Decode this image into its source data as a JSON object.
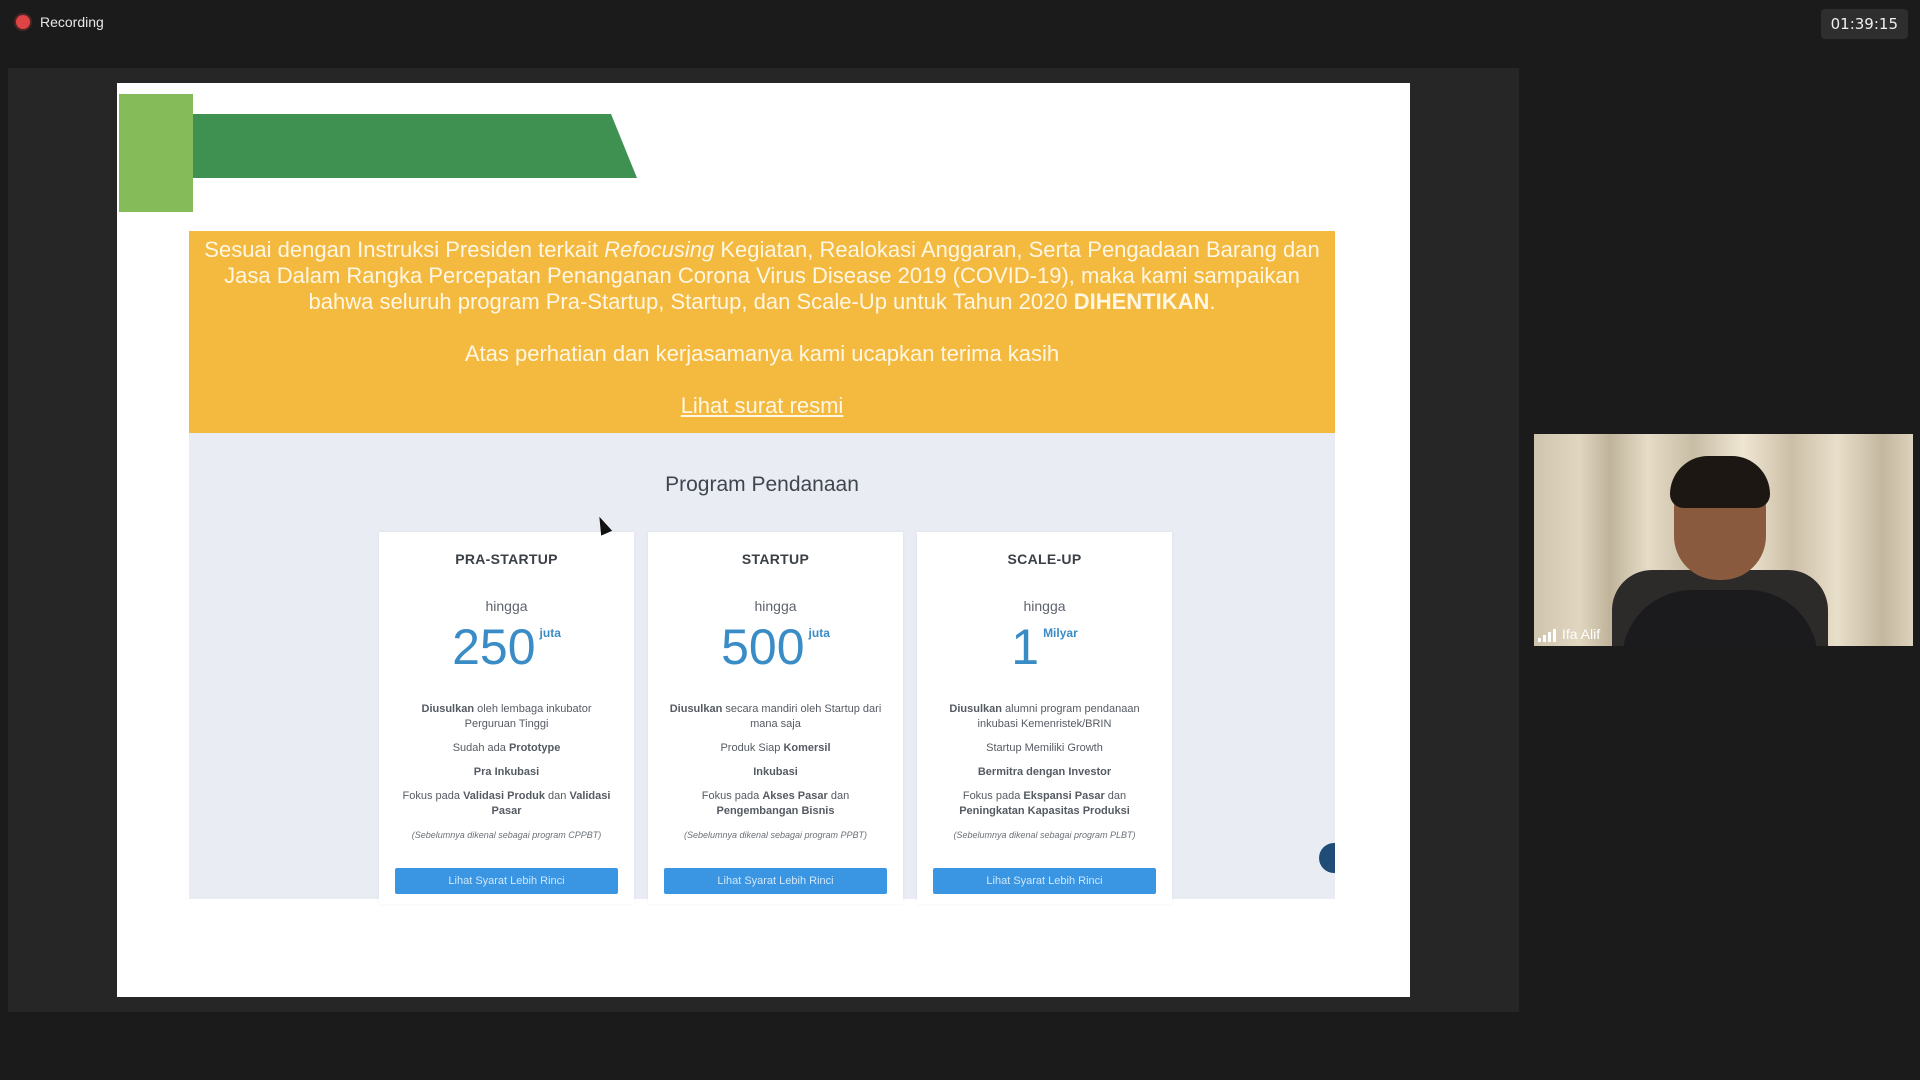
{
  "recording": {
    "label": "Recording"
  },
  "timer": "01:39:15",
  "slide": {
    "banner": {
      "line1_before": "Sesuai dengan Instruksi Presiden terkait ",
      "line1_italic": "Refocusing",
      "line1_after": " Kegiatan, Realokasi Anggaran, Serta Pengadaan Barang dan Jasa Dalam Rangka Percepatan Penanganan Corona Virus Disease 2019 (COVID-19), maka kami sampaikan bahwa seluruh program Pra-Startup, Startup, dan Scale-Up untuk Tahun 2020 ",
      "line1_bold": "DIHENTIKAN",
      "line1_end": ".",
      "thanks": "Atas perhatian dan kerjasamanya kami ucapkan terima kasih",
      "link": "Lihat surat resmi"
    },
    "section_title": "Program Pendanaan",
    "cards": [
      {
        "title": "PRA-STARTUP",
        "upto": "hingga",
        "amount": "250",
        "unit": "juta",
        "f1_bold": "Diusulkan",
        "f1_rest": " oleh lembaga inkubator Perguruan Tinggi",
        "f2_rest": "Sudah ada ",
        "f2_bold": "Prototype",
        "f3": "Pra Inkubasi",
        "f4_pre": "Fokus pada ",
        "f4_b1": "Validasi Produk",
        "f4_mid": " dan ",
        "f4_b2": "Validasi Pasar",
        "note": "(Sebelumnya dikenal sebagai program CPPBT)",
        "button": "Lihat Syarat Lebih Rinci"
      },
      {
        "title": "STARTUP",
        "upto": "hingga",
        "amount": "500",
        "unit": "juta",
        "f1_bold": "Diusulkan",
        "f1_rest": " secara mandiri oleh Startup dari mana saja",
        "f2_rest": "Produk Siap ",
        "f2_bold": "Komersil",
        "f3": "Inkubasi",
        "f4_pre": "Fokus pada ",
        "f4_b1": "Akses Pasar",
        "f4_mid": " dan ",
        "f4_b2": "Pengembangan Bisnis",
        "note": "(Sebelumnya dikenal sebagai program PPBT)",
        "button": "Lihat Syarat Lebih Rinci"
      },
      {
        "title": "SCALE-UP",
        "upto": "hingga",
        "amount": "1",
        "unit": "Milyar",
        "f1_bold": "Diusulkan",
        "f1_rest": " alumni program pendanaan inkubasi Kemenristek/BRIN",
        "f2_rest": "Startup Memiliki Growth",
        "f2_bold": "",
        "f3": "Bermitra dengan Investor",
        "f4_pre": "Fokus pada ",
        "f4_b1": "Ekspansi Pasar",
        "f4_mid": " dan ",
        "f4_b2": "Peningkatan Kapasitas Produksi",
        "note": "(Sebelumnya dikenal sebagai program PLBT)",
        "button": "Lihat Syarat Lebih Rinci"
      }
    ]
  },
  "participant": {
    "name": "Ifa Alif"
  }
}
